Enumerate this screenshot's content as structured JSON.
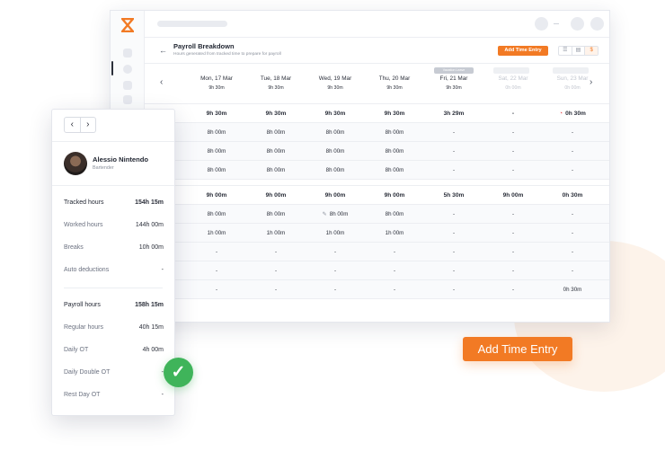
{
  "colors": {
    "accent": "#f27a24",
    "success": "#3fb45a",
    "warning": "#e5484d"
  },
  "page": {
    "title": "Payroll Breakdown",
    "subtitle": "Hours generated from tracked time to prepare for payroll",
    "add_entry_small": "Add Time Entry",
    "add_entry_big": "Add Time Entry",
    "view_icons": [
      "list-icon",
      "grid-icon",
      "dollar-icon"
    ]
  },
  "days": [
    {
      "name": "Mon, 17 Mar",
      "hours": "9h 30m",
      "muted": false,
      "badge": ""
    },
    {
      "name": "Tue, 18 Mar",
      "hours": "9h 30m",
      "muted": false,
      "badge": ""
    },
    {
      "name": "Wed, 19 Mar",
      "hours": "9h 30m",
      "muted": false,
      "badge": ""
    },
    {
      "name": "Thu, 20 Mar",
      "hours": "9h 30m",
      "muted": false,
      "badge": ""
    },
    {
      "name": "Fri, 21 Mar",
      "hours": "9h 30m",
      "muted": false,
      "badge": "Vacation Leave"
    },
    {
      "name": "Sat, 22 Mar",
      "hours": "0h 00m",
      "muted": true,
      "badge": ""
    },
    {
      "name": "Sun, 23 Mar",
      "hours": "0h 00m",
      "muted": true,
      "badge": ""
    }
  ],
  "rows": [
    {
      "sum": true,
      "cells": [
        "9h 30m",
        "9h 30m",
        "9h 30m",
        "9h 30m",
        "3h 29m",
        "-",
        "0h 30m"
      ]
    },
    {
      "sum": false,
      "cells": [
        "8h 00m",
        "8h 00m",
        "8h 00m",
        "8h 00m",
        "-",
        "-",
        "-"
      ]
    },
    {
      "sum": false,
      "cells": [
        "8h 00m",
        "8h 00m",
        "8h 00m",
        "8h 00m",
        "-",
        "-",
        "-"
      ]
    },
    {
      "sum": false,
      "cells": [
        "8h 00m",
        "8h 00m",
        "8h 00m",
        "8h 00m",
        "-",
        "-",
        "-"
      ]
    },
    {
      "sum": true,
      "cells": [
        "9h 00m",
        "9h 00m",
        "9h 00m",
        "9h 00m",
        "5h 30m",
        "9h 00m",
        "0h 30m"
      ]
    },
    {
      "sum": false,
      "cells": [
        "8h 00m",
        "8h 00m",
        "8h 00m",
        "8h 00m",
        "-",
        "-",
        "-"
      ]
    },
    {
      "sum": false,
      "cells": [
        "1h 00m",
        "1h 00m",
        "1h 00m",
        "1h 00m",
        "-",
        "-",
        "-"
      ]
    },
    {
      "sum": false,
      "cells": [
        "-",
        "-",
        "-",
        "-",
        "-",
        "-",
        "-"
      ]
    },
    {
      "sum": false,
      "cells": [
        "-",
        "-",
        "-",
        "-",
        "-",
        "-",
        "-"
      ]
    },
    {
      "sum": false,
      "cells": [
        "-",
        "-",
        "-",
        "-",
        "-",
        "-",
        "0h 30m"
      ]
    }
  ],
  "employee": {
    "name": "Alessio Nintendo",
    "role": "Bartender"
  },
  "summary": [
    {
      "label": "Tracked hours",
      "value": "154h 15m",
      "bold": true
    },
    {
      "label": "Worked hours",
      "value": "144h 00m",
      "bold": false
    },
    {
      "label": "Breaks",
      "value": "10h 00m",
      "bold": false
    },
    {
      "label": "Auto deductions",
      "value": "-",
      "bold": false
    },
    {
      "label": "Payroll hours",
      "value": "158h 15m",
      "bold": true
    },
    {
      "label": "Regular hours",
      "value": "40h 15m",
      "bold": false
    },
    {
      "label": "Daily OT",
      "value": "4h 00m",
      "bold": false
    },
    {
      "label": "Daily Double OT",
      "value": "-",
      "bold": false
    },
    {
      "label": "Rest Day OT",
      "value": "-",
      "bold": false
    }
  ],
  "icons": {
    "prev": "‹",
    "next": "›",
    "back": "←",
    "check": "✓",
    "pager_prev": "‹",
    "pager_next": "›",
    "clock": "◔",
    "pencil": "✎"
  }
}
